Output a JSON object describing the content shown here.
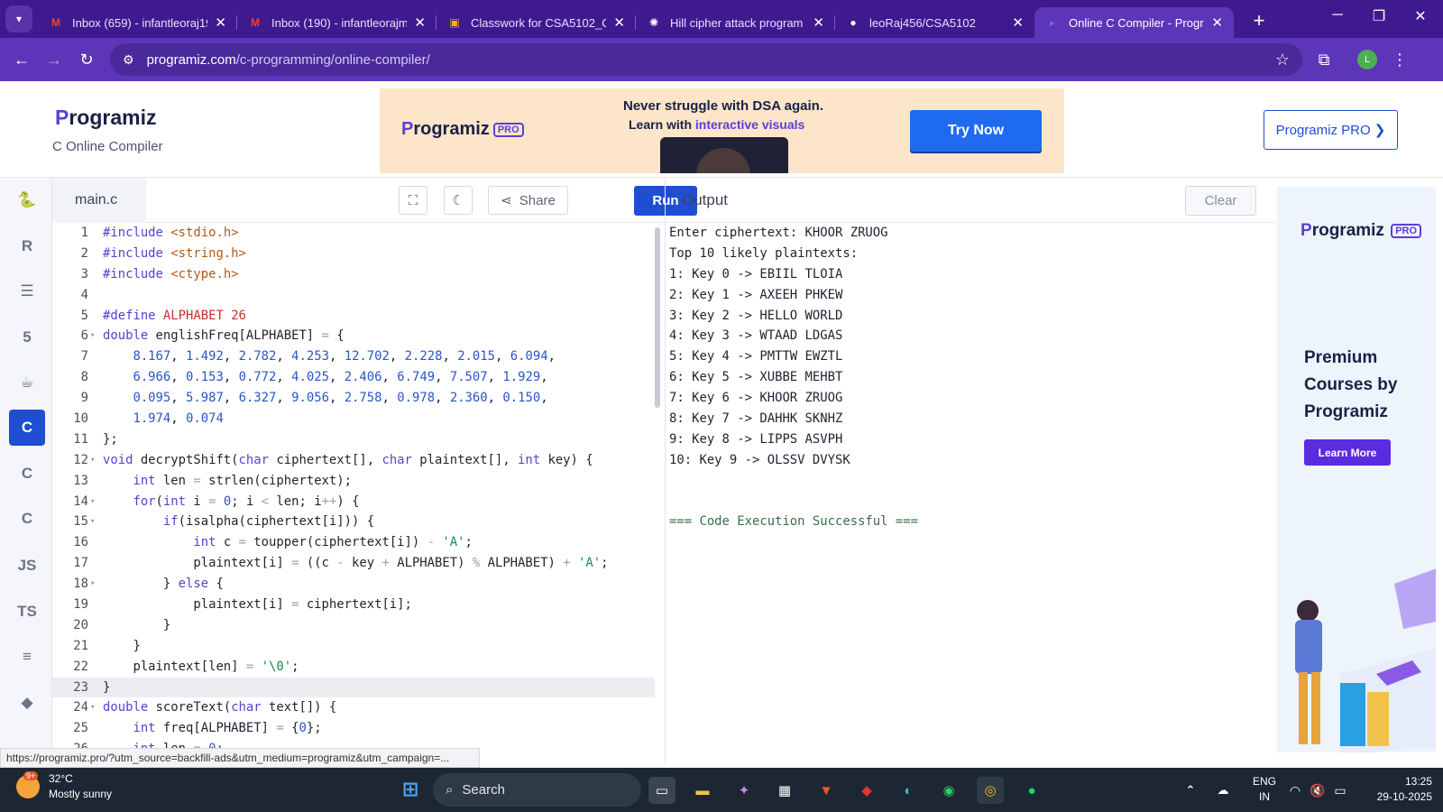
{
  "browser": {
    "tabs": [
      {
        "title": "Inbox (659) - infantleoraj19",
        "icon": "gmail-icon",
        "active": false
      },
      {
        "title": "Inbox (190) - infantleorajm",
        "icon": "gmail-icon",
        "active": false
      },
      {
        "title": "Classwork for CSA5102_CN",
        "icon": "classroom-icon",
        "active": false
      },
      {
        "title": "Hill cipher attack program",
        "icon": "chatgpt-icon",
        "active": false
      },
      {
        "title": "leoRaj456/CSA5102",
        "icon": "github-icon",
        "active": false
      },
      {
        "title": "Online C Compiler - Progra",
        "icon": "programiz-icon",
        "active": true
      }
    ],
    "url_host": "programiz.com",
    "url_path": "/c-programming/online-compiler/",
    "profile_initial": "L"
  },
  "site": {
    "logo": "Programiz",
    "subtitle": "C Online Compiler",
    "pro_button": "Programiz PRO ❯",
    "ad": {
      "logo": "Programiz",
      "pro_badge": "PRO",
      "line1": "Never struggle with DSA again.",
      "line2_prefix": "Learn with ",
      "line2_highlight": "interactive visuals",
      "cta": "Try Now"
    }
  },
  "editor": {
    "filename": "main.c",
    "share_label": "Share",
    "run_label": "Run",
    "current_line": 23
  },
  "output": {
    "title": "Output",
    "clear_label": "Clear",
    "lines": [
      "Enter ciphertext: KHOOR ZRUOG",
      "Top 10 likely plaintexts:",
      "1: Key 0 -> EBIIL TLOIA",
      "2: Key 1 -> AXEEH PHKEW",
      "3: Key 2 -> HELLO WORLD",
      "4: Key 3 -> WTAAD LDGAS",
      "5: Key 4 -> PMTTW EWZTL",
      "6: Key 5 -> XUBBE MEHBT",
      "7: Key 6 -> KHOOR ZRUOG",
      "8: Key 7 -> DAHHK SKNHZ",
      "9: Key 8 -> LIPPS ASVPH",
      "10: Key 9 -> OLSSV DVYSK",
      "",
      "",
      "=== Code Execution Successful ==="
    ]
  },
  "side_ad": {
    "logo": "Programiz",
    "pro_badge": "PRO",
    "headline": "Premium Courses by Programiz",
    "cta": "Learn More"
  },
  "rail": {
    "items": [
      {
        "name": "python-icon",
        "label": "🐍"
      },
      {
        "name": "r-icon",
        "label": "R"
      },
      {
        "name": "sql-icon",
        "label": "☰"
      },
      {
        "name": "html-icon",
        "label": "5"
      },
      {
        "name": "java-icon",
        "label": "☕"
      },
      {
        "name": "c-icon",
        "label": "C"
      },
      {
        "name": "cpp-icon",
        "label": "C"
      },
      {
        "name": "csharp-icon",
        "label": "C"
      },
      {
        "name": "js-icon",
        "label": "JS"
      },
      {
        "name": "ts-icon",
        "label": "TS"
      },
      {
        "name": "go-icon",
        "label": "≡"
      },
      {
        "name": "swift-icon",
        "label": "◆"
      }
    ],
    "active_index": 5
  },
  "status_url": "https://programiz.pro/?utm_source=backfill-ads&utm_medium=programiz&utm_campaign=...",
  "taskbar": {
    "weather_temp": "32°C",
    "weather_desc": "Mostly sunny",
    "weather_badge": "9+",
    "search_placeholder": "Search",
    "lang_line1": "ENG",
    "lang_line2": "IN",
    "time": "13:25",
    "date": "29-10-2025"
  }
}
